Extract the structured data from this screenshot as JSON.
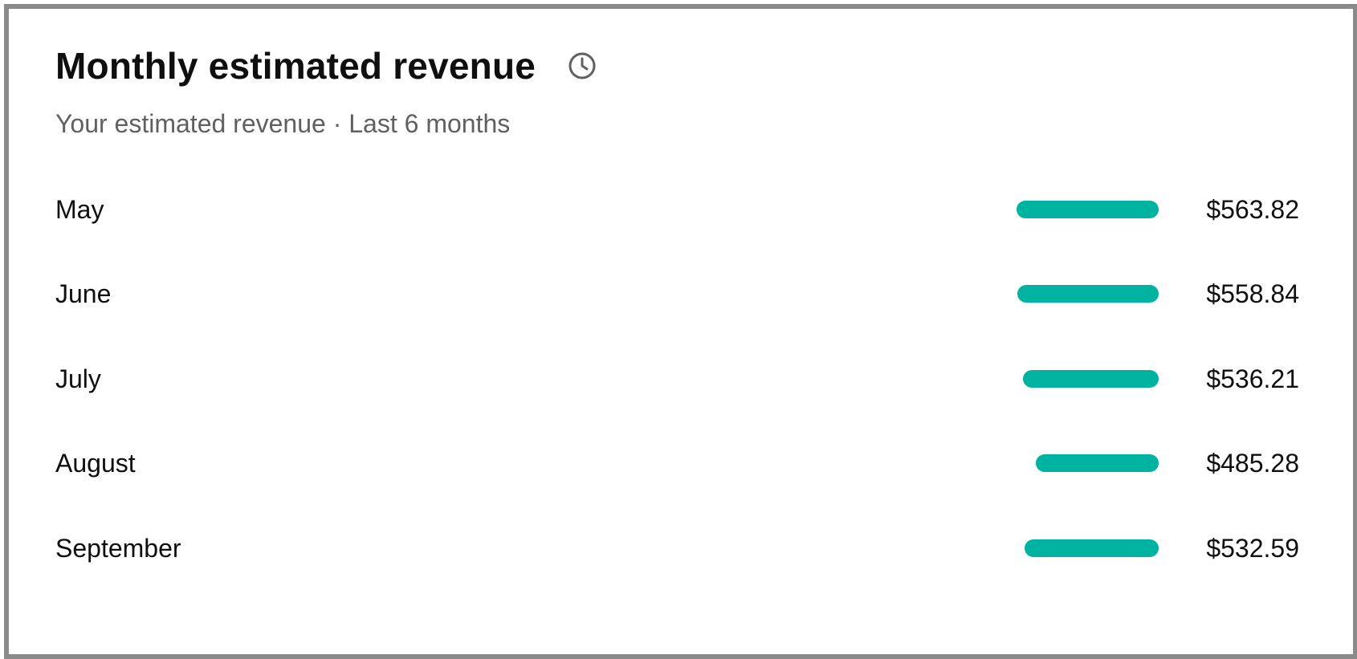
{
  "card": {
    "title": "Monthly estimated revenue",
    "subtitle": "Your estimated revenue · Last 6 months",
    "info_icon": "clock-icon"
  },
  "colors": {
    "bar": "#00b3a1",
    "title": "#0f0f0f",
    "subtitle": "#606060",
    "border": "#8a8a8a"
  },
  "chart_data": {
    "type": "bar",
    "orientation": "horizontal",
    "categories": [
      "May",
      "June",
      "July",
      "August",
      "September"
    ],
    "values": [
      563.82,
      558.84,
      536.21,
      485.28,
      532.59
    ],
    "value_labels": [
      "$563.82",
      "$558.84",
      "$536.21",
      "$485.28",
      "$532.59"
    ],
    "xlim": [
      0,
      1120
    ]
  },
  "rows": [
    {
      "label": "May",
      "value": "$563.82",
      "amount": 563.82
    },
    {
      "label": "June",
      "value": "$558.84",
      "amount": 558.84
    },
    {
      "label": "July",
      "value": "$536.21",
      "amount": 536.21
    },
    {
      "label": "August",
      "value": "$485.28",
      "amount": 485.28
    },
    {
      "label": "September",
      "value": "$532.59",
      "amount": 532.59
    }
  ]
}
